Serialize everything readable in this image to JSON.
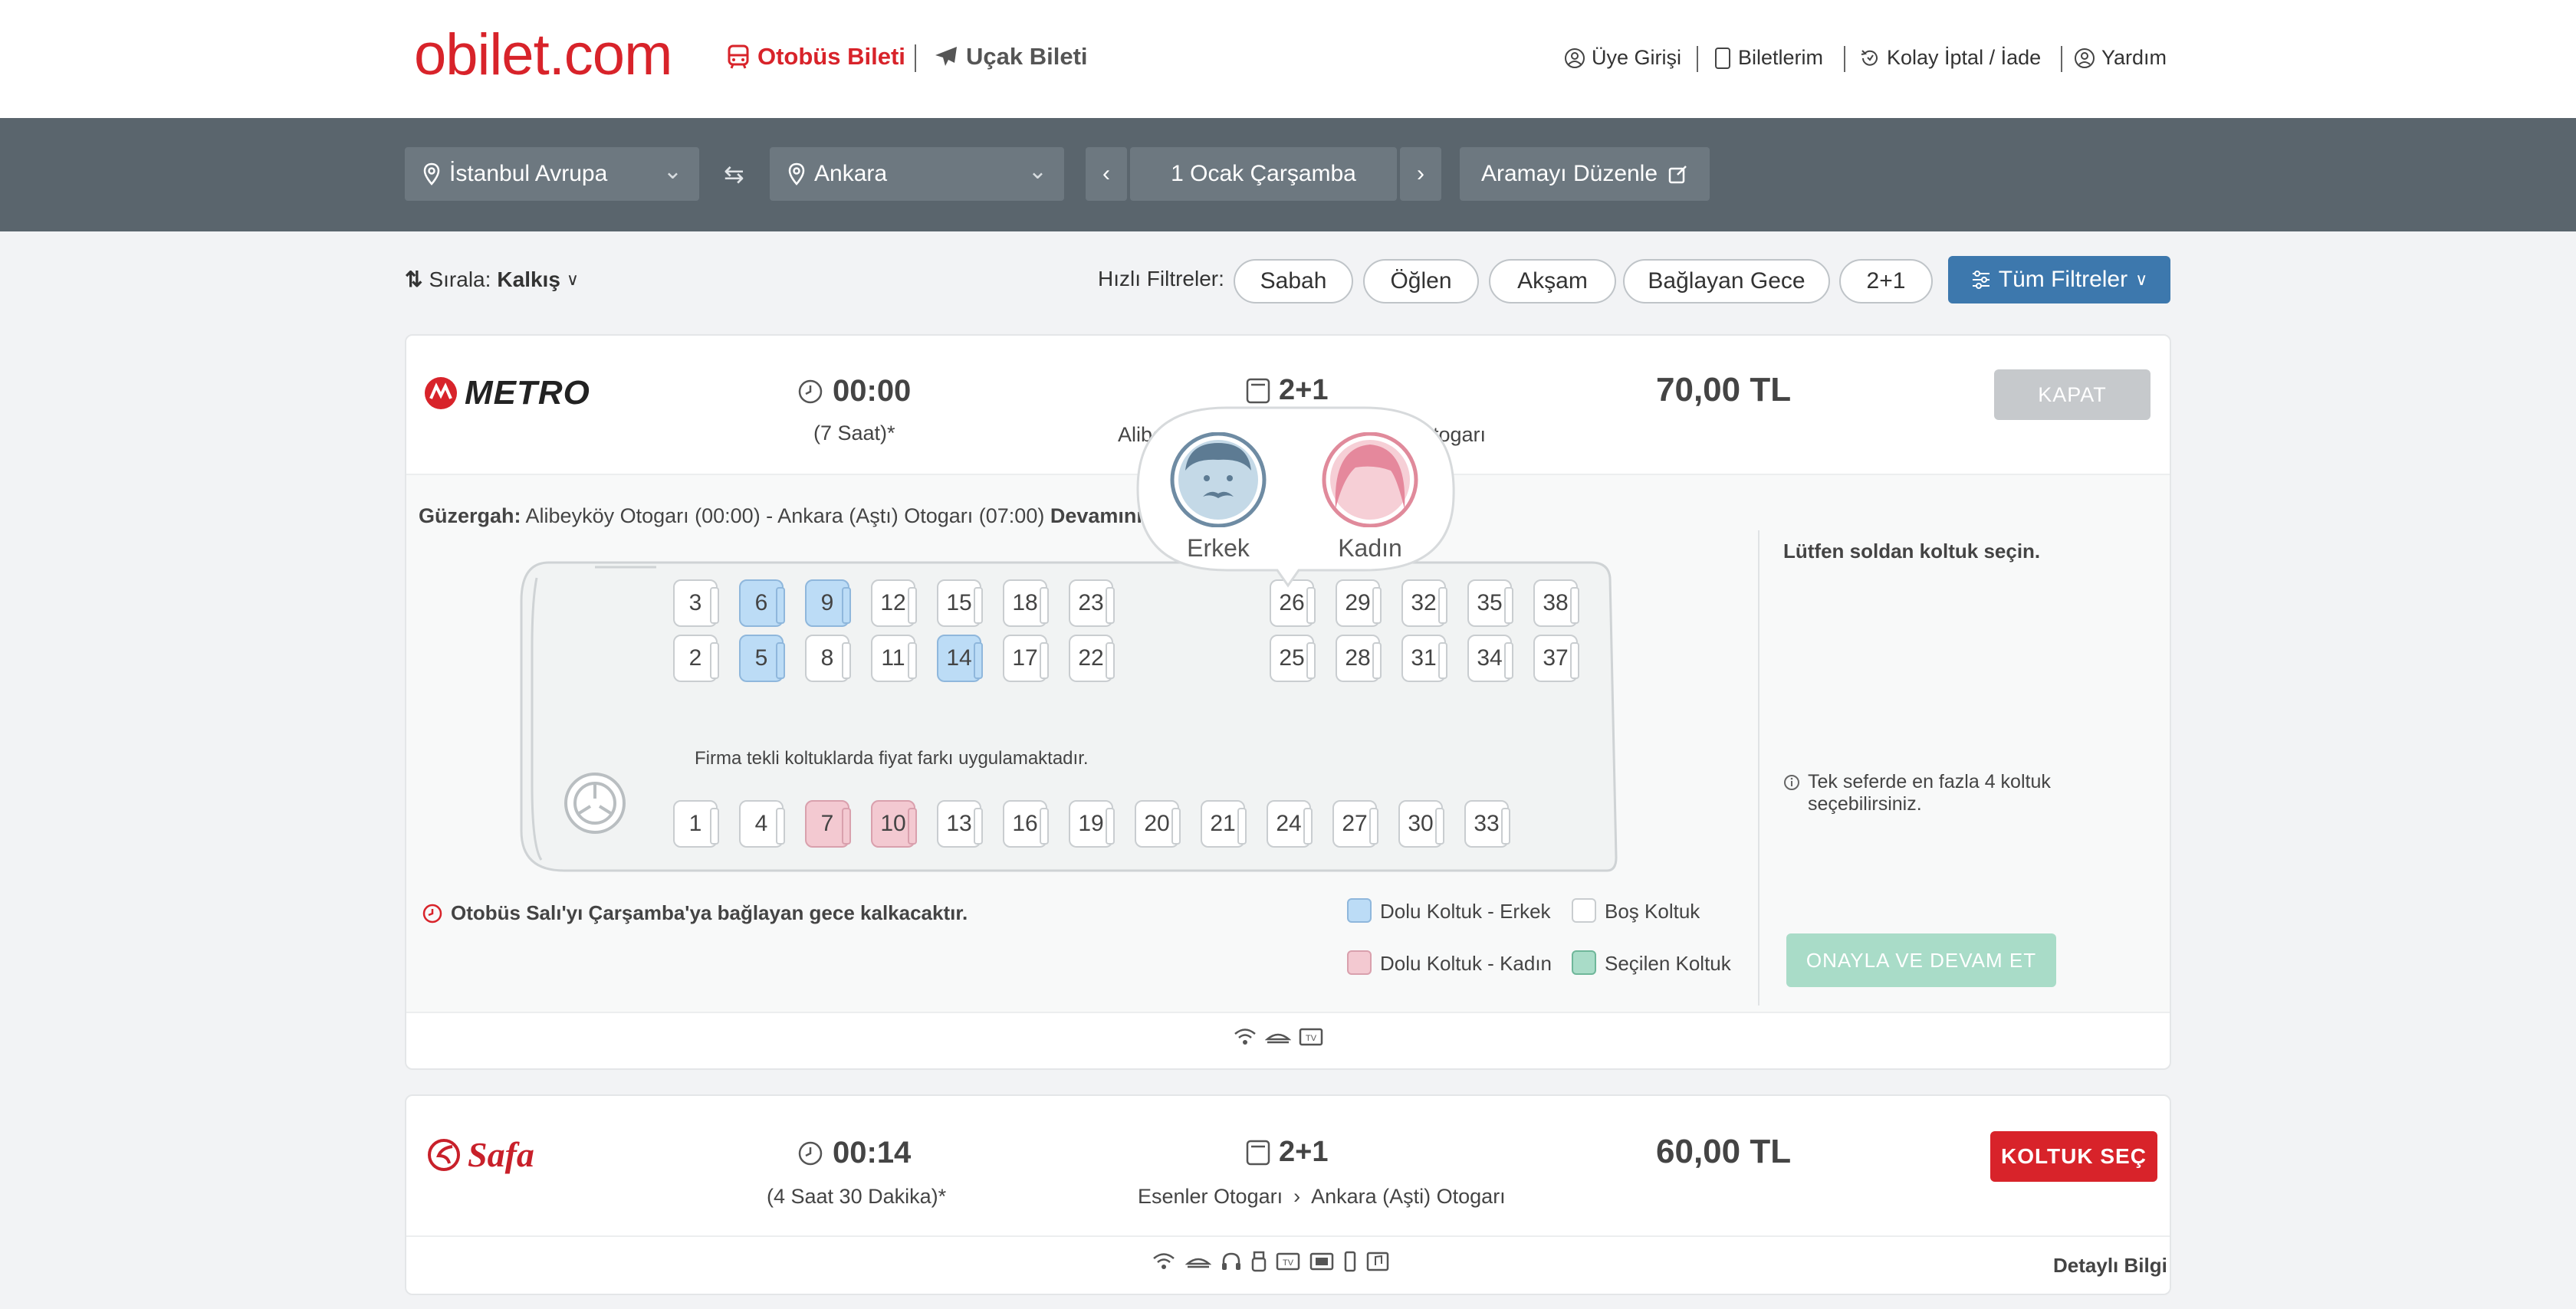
{
  "header": {
    "logo_main": "obilet",
    "logo_dom": ".com",
    "tab_bus": "Otobüs Bileti",
    "tab_plane": "Uçak Bileti",
    "links": [
      "Üye Girişi",
      "Biletlerim",
      "Kolay İptal / İade",
      "Yardım"
    ]
  },
  "search": {
    "from": "İstanbul Avrupa",
    "to": "Ankara",
    "date": "1 Ocak Çarşamba",
    "edit": "Aramayı Düzenle"
  },
  "sort": {
    "label": "Sırala:",
    "value": "Kalkış"
  },
  "filters": {
    "label": "Hızlı Filtreler:",
    "chips": [
      "Sabah",
      "Öğlen",
      "Akşam",
      "Bağlayan Gece",
      "2+1"
    ],
    "all": "Tüm Filtreler"
  },
  "trip1": {
    "company": "METRO",
    "time": "00:00",
    "duration": "(7 Saat)*",
    "layout": "2+1",
    "route_left": "Alibe",
    "route_right": "Otogarı",
    "price": "70,00 TL",
    "close_button": "KAPAT",
    "route_label": "Güzergah:",
    "route_text": "Alibeyköy Otogarı (00:00) - Ankara (Aştı) Otogarı (07:00)",
    "route_more": "Devamını",
    "gender_popup": {
      "male": "Erkek",
      "female": "Kadın"
    },
    "seats_top": [
      {
        "n": "3",
        "s": "empty"
      },
      {
        "n": "6",
        "s": "male"
      },
      {
        "n": "9",
        "s": "male"
      },
      {
        "n": "12",
        "s": "empty"
      },
      {
        "n": "15",
        "s": "empty"
      },
      {
        "n": "18",
        "s": "empty"
      },
      {
        "n": "23",
        "s": "empty"
      },
      {
        "n": "26",
        "s": "empty"
      },
      {
        "n": "29",
        "s": "empty"
      },
      {
        "n": "32",
        "s": "empty"
      },
      {
        "n": "35",
        "s": "empty"
      },
      {
        "n": "38",
        "s": "empty"
      }
    ],
    "seats_mid": [
      {
        "n": "2",
        "s": "empty"
      },
      {
        "n": "5",
        "s": "male"
      },
      {
        "n": "8",
        "s": "empty"
      },
      {
        "n": "11",
        "s": "empty"
      },
      {
        "n": "14",
        "s": "male"
      },
      {
        "n": "17",
        "s": "empty"
      },
      {
        "n": "22",
        "s": "empty"
      },
      {
        "n": "25",
        "s": "empty"
      },
      {
        "n": "28",
        "s": "empty"
      },
      {
        "n": "31",
        "s": "empty"
      },
      {
        "n": "34",
        "s": "empty"
      },
      {
        "n": "37",
        "s": "empty"
      }
    ],
    "seats_bottom": [
      {
        "n": "1",
        "s": "empty"
      },
      {
        "n": "4",
        "s": "empty"
      },
      {
        "n": "7",
        "s": "female"
      },
      {
        "n": "10",
        "s": "female"
      },
      {
        "n": "13",
        "s": "empty"
      },
      {
        "n": "16",
        "s": "empty"
      },
      {
        "n": "19",
        "s": "empty"
      },
      {
        "n": "20",
        "s": "empty"
      },
      {
        "n": "21",
        "s": "empty"
      },
      {
        "n": "24",
        "s": "empty"
      },
      {
        "n": "27",
        "s": "empty"
      },
      {
        "n": "30",
        "s": "empty"
      },
      {
        "n": "33",
        "s": "empty"
      }
    ],
    "price_note": "Firma tekli koltuklarda fiyat farkı uygulamaktadır.",
    "night_note": "Otobüs Salı'yı Çarşamba'ya bağlayan gece kalkacaktır.",
    "legend": {
      "male": "Dolu Koltuk - Erkek",
      "empty": "Boş Koltuk",
      "female": "Dolu Koltuk - Kadın",
      "selected": "Seçilen Koltuk"
    },
    "select_hint": "Lütfen soldan koltuk seçin.",
    "max_note": "Tek seferde en fazla 4 koltuk seçebilirsiniz.",
    "confirm": "ONAYLA VE DEVAM ET",
    "colors": {
      "male": "#bcdcf6",
      "female": "#f3c9d1",
      "selected": "#a9dcc8"
    }
  },
  "trip2": {
    "company": "Safa",
    "time": "00:14",
    "duration": "(4 Saat 30 Dakika)*",
    "layout": "2+1",
    "route_from": "Esenler Otogarı",
    "route_to": "Ankara (Aşti) Otogarı",
    "price": "60,00 TL",
    "select_button": "KOLTUK SEÇ",
    "details": "Detaylı Bilgi"
  }
}
